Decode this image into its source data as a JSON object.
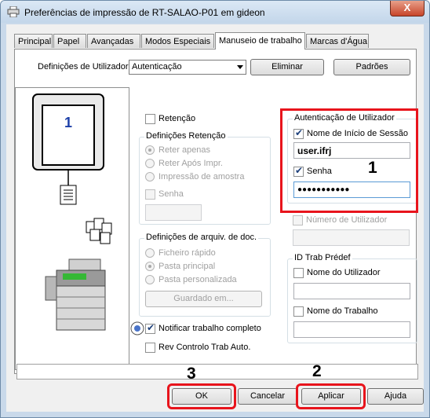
{
  "window": {
    "title": "Preferências de impressão de RT-SALAO-P01 em gideon",
    "close_glyph": "X"
  },
  "tabs": [
    {
      "label": "Principal"
    },
    {
      "label": "Papel"
    },
    {
      "label": "Avançadas"
    },
    {
      "label": "Modos Especiais"
    },
    {
      "label": "Manuseio de trabalho",
      "active": true
    },
    {
      "label": "Marcas d'Água"
    }
  ],
  "user_settings": {
    "label": "Definições de Utilizador:",
    "selected": "Autenticação",
    "delete_label": "Eliminar",
    "defaults_label": "Padrões"
  },
  "preview": {
    "page_number": "1"
  },
  "retention": {
    "checkbox_label": "Retenção",
    "group_label": "Definições Retenção",
    "options": [
      "Reter apenas",
      "Reter Após Impr.",
      "Impressão de amostra"
    ],
    "password_label": "Senha"
  },
  "doc_filing": {
    "group_label": "Definições de arquiv. de doc.",
    "options": [
      "Ficheiro rápido",
      "Pasta principal",
      "Pasta personalizada"
    ],
    "saved_button": "Guardado em..."
  },
  "notify": {
    "complete_label": "Notificar trabalho completo",
    "auto_check_label": "Rev Controlo Trab Auto."
  },
  "auth": {
    "group_label": "Autenticação de Utilizador",
    "login_label": "Nome de Início de Sessão",
    "login_value": "user.ifrj",
    "password_label": "Senha",
    "password_value": "●●●●●●●●●●●"
  },
  "user_number": {
    "label": "Número de Utilizador"
  },
  "job_id": {
    "group_label": "ID Trab Prédef",
    "username_label": "Nome do Utilizador",
    "jobname_label": "Nome do Trabalho"
  },
  "footer": {
    "ok": "OK",
    "cancel": "Cancelar",
    "apply": "Aplicar",
    "help": "Ajuda"
  },
  "annotations": {
    "step1": "1",
    "step2": "2",
    "step3": "3"
  },
  "colors": {
    "annotation_red": "#e8141c",
    "titlebar": "#c9d9ea"
  }
}
